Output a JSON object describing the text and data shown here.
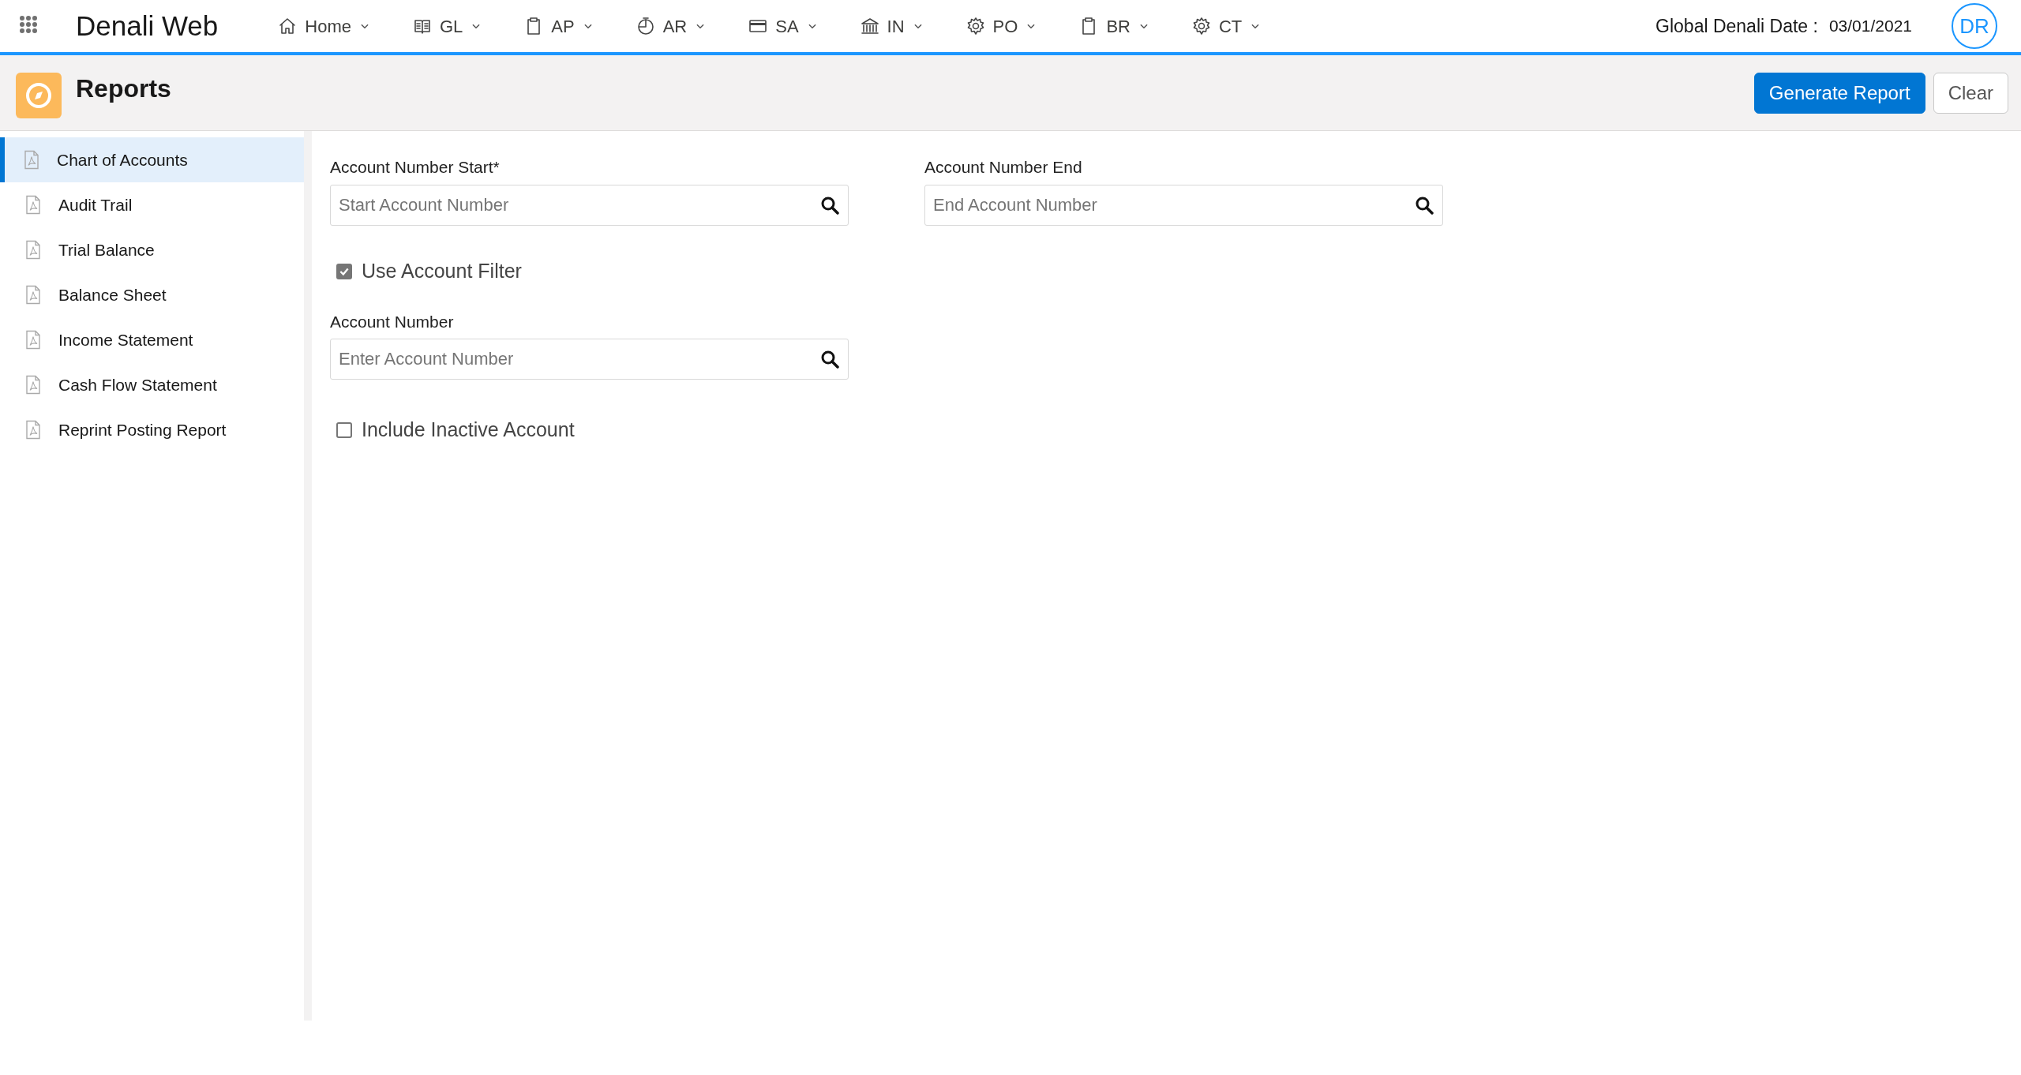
{
  "app": {
    "title": "Denali Web",
    "date_label": "Global Denali Date :",
    "date": "03/01/2021",
    "avatar": "DR"
  },
  "nav": [
    {
      "label": "Home",
      "kind": "home"
    },
    {
      "label": "GL",
      "kind": "book"
    },
    {
      "label": "AP",
      "kind": "clipboard"
    },
    {
      "label": "AR",
      "kind": "clock"
    },
    {
      "label": "SA",
      "kind": "card"
    },
    {
      "label": "IN",
      "kind": "bank"
    },
    {
      "label": "PO",
      "kind": "gear"
    },
    {
      "label": "BR",
      "kind": "clipboard"
    },
    {
      "label": "CT",
      "kind": "gear"
    }
  ],
  "page_header": {
    "title": "Reports",
    "buttons": [
      {
        "label": "Generate Report",
        "kind": "primary"
      },
      {
        "label": "Clear",
        "kind": "neutral"
      }
    ]
  },
  "sidebar": {
    "items": [
      {
        "label": "Chart of Accounts",
        "selected": true
      },
      {
        "label": "Audit Trail",
        "selected": false
      },
      {
        "label": "Trial Balance",
        "selected": false
      },
      {
        "label": "Balance Sheet",
        "selected": false
      },
      {
        "label": "Income Statement",
        "selected": false
      },
      {
        "label": "Cash Flow Statement",
        "selected": false
      },
      {
        "label": "Reprint Posting Report",
        "selected": false
      }
    ]
  },
  "form": {
    "range_fields": [
      {
        "label": "Account Number Start*",
        "placeholder": "Start Account Number"
      },
      {
        "label": "Account Number End",
        "placeholder": "End Account Number"
      }
    ],
    "use_filter": {
      "label": "Use Account Filter",
      "checked": true
    },
    "account_field": {
      "label": "Account Number",
      "placeholder": "Enter Account Number"
    },
    "include_inactive": {
      "label": "Include Inactive Account",
      "checked": false
    }
  }
}
